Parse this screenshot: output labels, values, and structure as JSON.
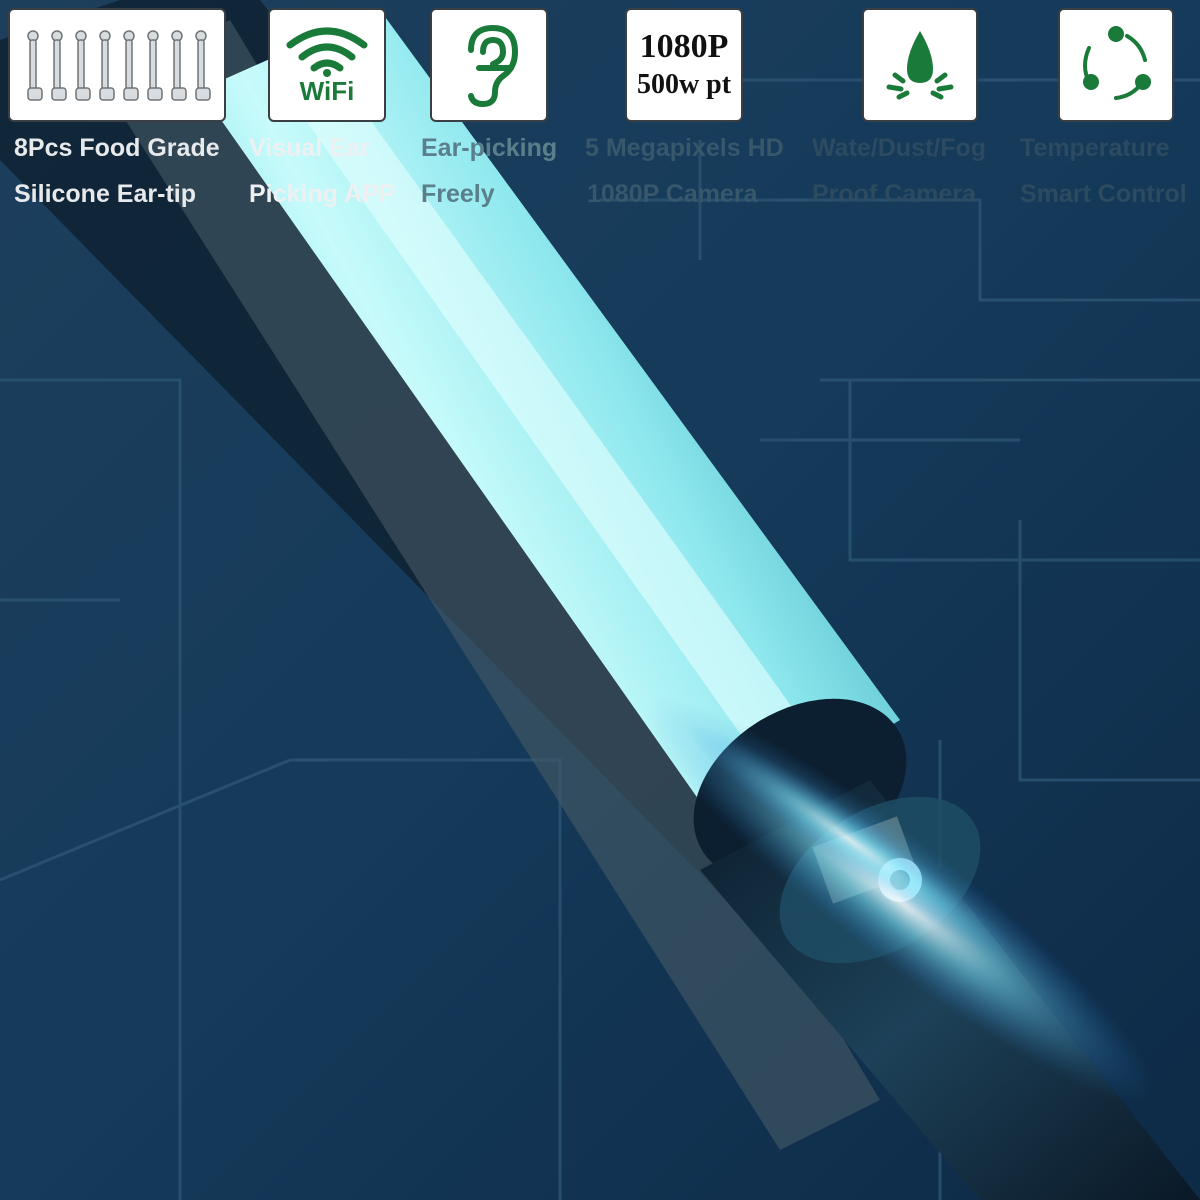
{
  "features": [
    {
      "icon": "ear-tips-icon",
      "caption_line1": "8Pcs Food Grade",
      "caption_line2": "Silicone Ear-tip"
    },
    {
      "icon": "wifi-icon",
      "icon_text": "WiFi",
      "caption_line1": "Visual Ear",
      "caption_line2": "Picking APP"
    },
    {
      "icon": "ear-icon",
      "caption_line1": "Ear-picking",
      "caption_line2": "Freely"
    },
    {
      "icon": "resolution-icon",
      "icon_line1": "1080P",
      "icon_line2": "500w pt",
      "caption_line1": "5 Megapixels HD",
      "caption_line2": "1080P Camera"
    },
    {
      "icon": "water-drop-icon",
      "caption_line1": "Wate/Dust/Fog",
      "caption_line2": "Proof Camera"
    },
    {
      "icon": "temperature-control-icon",
      "caption_line1": "Temperature",
      "caption_line2": "Smart Control"
    }
  ],
  "colors": {
    "icon_green": "#1a7a3a",
    "background_dark": "#14304a",
    "tube_glow": "#9ff4f6"
  }
}
